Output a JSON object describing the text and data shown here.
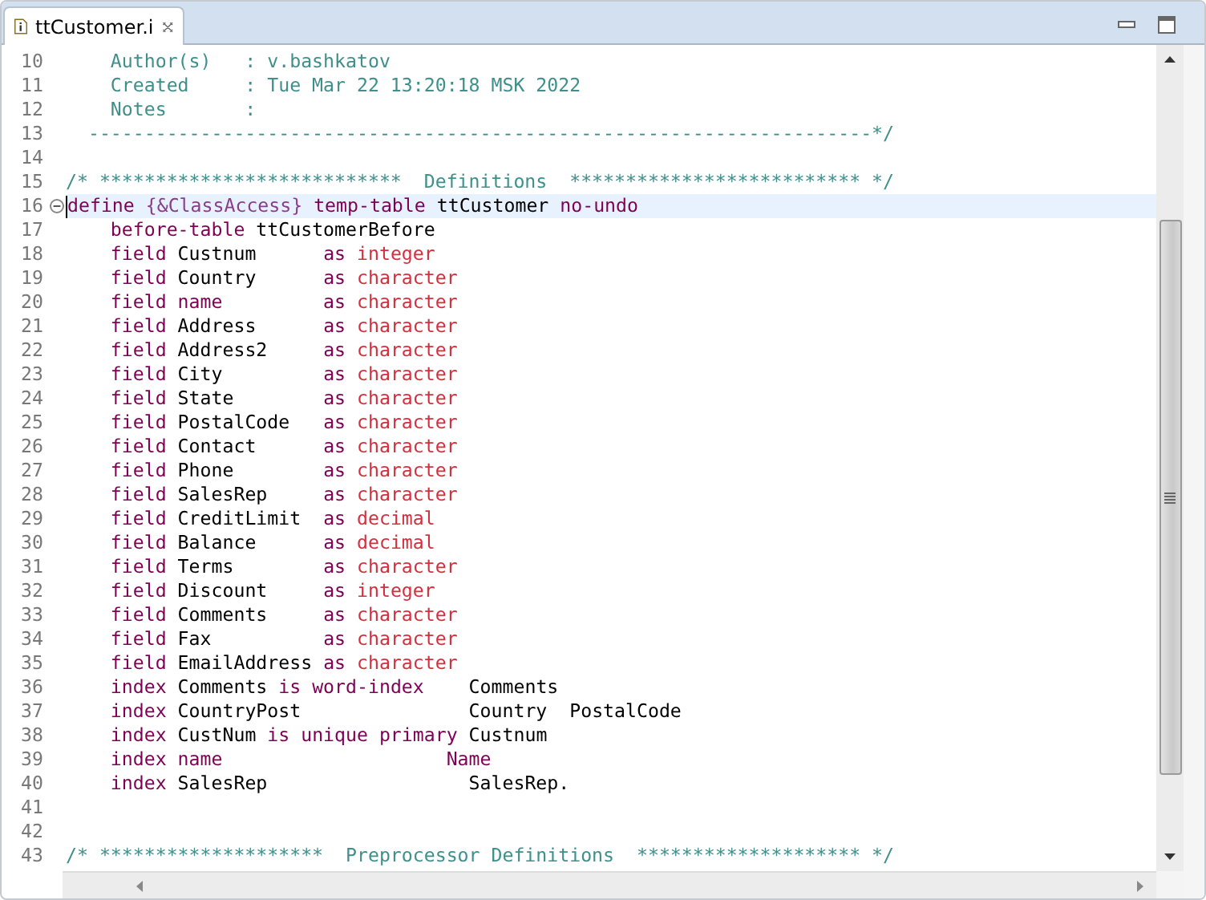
{
  "tab": {
    "title": "ttCustomer.i",
    "selected": true
  },
  "editor": {
    "lines": [
      {
        "number": "10",
        "current": false,
        "fold": false,
        "segments": [
          {
            "kind": "comment",
            "text": "    Author(s)   : v.bashkatov"
          }
        ]
      },
      {
        "number": "11",
        "current": false,
        "fold": false,
        "segments": [
          {
            "kind": "comment",
            "text": "    Created     : Tue Mar 22 13:20:18 MSK 2022"
          }
        ]
      },
      {
        "number": "12",
        "current": false,
        "fold": false,
        "segments": [
          {
            "kind": "comment",
            "text": "    Notes       :"
          }
        ]
      },
      {
        "number": "13",
        "current": false,
        "fold": false,
        "segments": [
          {
            "kind": "comment",
            "text": "  ----------------------------------------------------------------------*/"
          }
        ]
      },
      {
        "number": "14",
        "current": false,
        "fold": false
      },
      {
        "number": "15",
        "current": false,
        "fold": false,
        "segments": [
          {
            "kind": "comment",
            "text": "/* ***************************  Definitions  ************************** */"
          }
        ]
      },
      {
        "number": "16",
        "current": true,
        "fold": true,
        "segments": [
          {
            "kind": "keyword",
            "text": "define"
          },
          {
            "kind": "preproc",
            "text": " {&ClassAccess}"
          },
          {
            "kind": "keyword",
            "text": " temp-table"
          },
          {
            "kind": "plain",
            "text": " ttCustomer "
          },
          {
            "kind": "keyword",
            "text": "no-undo"
          }
        ]
      },
      {
        "number": "17",
        "current": false,
        "fold": false,
        "segments": [
          {
            "kind": "keyword",
            "text": "    before-table"
          },
          {
            "kind": "plain",
            "text": " ttCustomerBefore"
          }
        ]
      },
      {
        "number": "18",
        "current": false,
        "fold": false,
        "segments": [
          {
            "kind": "keyword",
            "text": "    field"
          },
          {
            "kind": "plain",
            "text": " Custnum      "
          },
          {
            "kind": "keyword",
            "text": "as"
          },
          {
            "kind": "type",
            "text": " integer"
          }
        ]
      },
      {
        "number": "19",
        "current": false,
        "fold": false,
        "segments": [
          {
            "kind": "keyword",
            "text": "    field"
          },
          {
            "kind": "plain",
            "text": " Country      "
          },
          {
            "kind": "keyword",
            "text": "as"
          },
          {
            "kind": "type",
            "text": " character"
          }
        ]
      },
      {
        "number": "20",
        "current": false,
        "fold": false,
        "segments": [
          {
            "kind": "keyword",
            "text": "    field name         as"
          },
          {
            "kind": "type",
            "text": " character"
          }
        ]
      },
      {
        "number": "21",
        "current": false,
        "fold": false,
        "segments": [
          {
            "kind": "keyword",
            "text": "    field"
          },
          {
            "kind": "plain",
            "text": " Address      "
          },
          {
            "kind": "keyword",
            "text": "as"
          },
          {
            "kind": "type",
            "text": " character"
          }
        ]
      },
      {
        "number": "22",
        "current": false,
        "fold": false,
        "segments": [
          {
            "kind": "keyword",
            "text": "    field"
          },
          {
            "kind": "plain",
            "text": " Address2     "
          },
          {
            "kind": "keyword",
            "text": "as"
          },
          {
            "kind": "type",
            "text": " character"
          }
        ]
      },
      {
        "number": "23",
        "current": false,
        "fold": false,
        "segments": [
          {
            "kind": "keyword",
            "text": "    field"
          },
          {
            "kind": "plain",
            "text": " City         "
          },
          {
            "kind": "keyword",
            "text": "as"
          },
          {
            "kind": "type",
            "text": " character"
          }
        ]
      },
      {
        "number": "24",
        "current": false,
        "fold": false,
        "segments": [
          {
            "kind": "keyword",
            "text": "    field"
          },
          {
            "kind": "plain",
            "text": " State        "
          },
          {
            "kind": "keyword",
            "text": "as"
          },
          {
            "kind": "type",
            "text": " character"
          }
        ]
      },
      {
        "number": "25",
        "current": false,
        "fold": false,
        "segments": [
          {
            "kind": "keyword",
            "text": "    field"
          },
          {
            "kind": "plain",
            "text": " PostalCode   "
          },
          {
            "kind": "keyword",
            "text": "as"
          },
          {
            "kind": "type",
            "text": " character"
          }
        ]
      },
      {
        "number": "26",
        "current": false,
        "fold": false,
        "segments": [
          {
            "kind": "keyword",
            "text": "    field"
          },
          {
            "kind": "plain",
            "text": " Contact      "
          },
          {
            "kind": "keyword",
            "text": "as"
          },
          {
            "kind": "type",
            "text": " character"
          }
        ]
      },
      {
        "number": "27",
        "current": false,
        "fold": false,
        "segments": [
          {
            "kind": "keyword",
            "text": "    field"
          },
          {
            "kind": "plain",
            "text": " Phone        "
          },
          {
            "kind": "keyword",
            "text": "as"
          },
          {
            "kind": "type",
            "text": " character"
          }
        ]
      },
      {
        "number": "28",
        "current": false,
        "fold": false,
        "segments": [
          {
            "kind": "keyword",
            "text": "    field"
          },
          {
            "kind": "plain",
            "text": " SalesRep     "
          },
          {
            "kind": "keyword",
            "text": "as"
          },
          {
            "kind": "type",
            "text": " character"
          }
        ]
      },
      {
        "number": "29",
        "current": false,
        "fold": false,
        "segments": [
          {
            "kind": "keyword",
            "text": "    field"
          },
          {
            "kind": "plain",
            "text": " CreditLimit  "
          },
          {
            "kind": "keyword",
            "text": "as"
          },
          {
            "kind": "type",
            "text": " decimal"
          }
        ]
      },
      {
        "number": "30",
        "current": false,
        "fold": false,
        "segments": [
          {
            "kind": "keyword",
            "text": "    field"
          },
          {
            "kind": "plain",
            "text": " Balance      "
          },
          {
            "kind": "keyword",
            "text": "as"
          },
          {
            "kind": "type",
            "text": " decimal"
          }
        ]
      },
      {
        "number": "31",
        "current": false,
        "fold": false,
        "segments": [
          {
            "kind": "keyword",
            "text": "    field"
          },
          {
            "kind": "plain",
            "text": " Terms        "
          },
          {
            "kind": "keyword",
            "text": "as"
          },
          {
            "kind": "type",
            "text": " character"
          }
        ]
      },
      {
        "number": "32",
        "current": false,
        "fold": false,
        "segments": [
          {
            "kind": "keyword",
            "text": "    field"
          },
          {
            "kind": "plain",
            "text": " Discount     "
          },
          {
            "kind": "keyword",
            "text": "as"
          },
          {
            "kind": "type",
            "text": " integer"
          }
        ]
      },
      {
        "number": "33",
        "current": false,
        "fold": false,
        "segments": [
          {
            "kind": "keyword",
            "text": "    field"
          },
          {
            "kind": "plain",
            "text": " Comments     "
          },
          {
            "kind": "keyword",
            "text": "as"
          },
          {
            "kind": "type",
            "text": " character"
          }
        ]
      },
      {
        "number": "34",
        "current": false,
        "fold": false,
        "segments": [
          {
            "kind": "keyword",
            "text": "    field"
          },
          {
            "kind": "plain",
            "text": " Fax          "
          },
          {
            "kind": "keyword",
            "text": "as"
          },
          {
            "kind": "type",
            "text": " character"
          }
        ]
      },
      {
        "number": "35",
        "current": false,
        "fold": false,
        "segments": [
          {
            "kind": "keyword",
            "text": "    field"
          },
          {
            "kind": "plain",
            "text": " EmailAddress "
          },
          {
            "kind": "keyword",
            "text": "as"
          },
          {
            "kind": "type",
            "text": " character"
          }
        ]
      },
      {
        "number": "36",
        "current": false,
        "fold": false,
        "segments": [
          {
            "kind": "keyword",
            "text": "    index"
          },
          {
            "kind": "plain",
            "text": " Comments "
          },
          {
            "kind": "keyword",
            "text": "is word-index"
          },
          {
            "kind": "plain",
            "text": "    Comments"
          }
        ]
      },
      {
        "number": "37",
        "current": false,
        "fold": false,
        "segments": [
          {
            "kind": "keyword",
            "text": "    index"
          },
          {
            "kind": "plain",
            "text": " CountryPost               Country  PostalCode"
          }
        ]
      },
      {
        "number": "38",
        "current": false,
        "fold": false,
        "segments": [
          {
            "kind": "keyword",
            "text": "    index"
          },
          {
            "kind": "plain",
            "text": " CustNum "
          },
          {
            "kind": "keyword",
            "text": "is unique primary"
          },
          {
            "kind": "plain",
            "text": " Custnum"
          }
        ]
      },
      {
        "number": "39",
        "current": false,
        "fold": false,
        "segments": [
          {
            "kind": "keyword",
            "text": "    index name                    Name"
          }
        ]
      },
      {
        "number": "40",
        "current": false,
        "fold": false,
        "segments": [
          {
            "kind": "keyword",
            "text": "    index"
          },
          {
            "kind": "plain",
            "text": " SalesRep                  SalesRep."
          }
        ]
      },
      {
        "number": "41",
        "current": false,
        "fold": false
      },
      {
        "number": "42",
        "current": false,
        "fold": false
      },
      {
        "number": "43",
        "current": false,
        "fold": false,
        "segments": [
          {
            "kind": "comment",
            "text": "/* ********************  Preprocessor Definitions  ******************** */"
          }
        ]
      }
    ]
  }
}
